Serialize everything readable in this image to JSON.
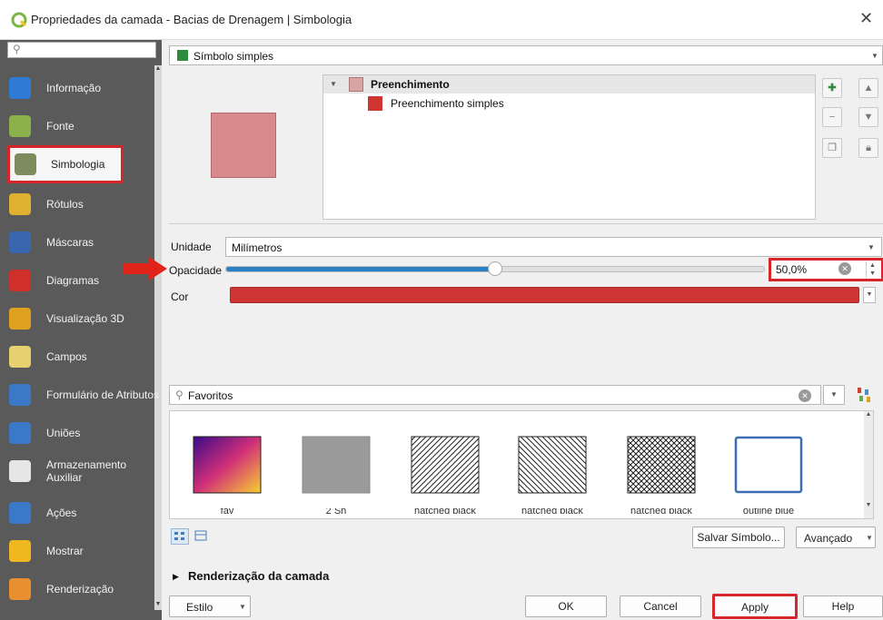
{
  "window": {
    "title": "Propriedades da camada - Bacias de Drenagem | Simbologia"
  },
  "sidebar": {
    "items": [
      {
        "label": "Informação",
        "icon": "info-icon",
        "color": "#2e7bd6"
      },
      {
        "label": "Fonte",
        "icon": "source-icon",
        "color": "#8bb14b"
      },
      {
        "label": "Simbologia",
        "icon": "symbology-brush-icon",
        "color": "#7e8b5f"
      },
      {
        "label": "Rótulos",
        "icon": "labels-abc-icon",
        "color": "#e0b030"
      },
      {
        "label": "Máscaras",
        "icon": "masks-abc-icon",
        "color": "#3a66b0"
      },
      {
        "label": "Diagramas",
        "icon": "diagrams-icon",
        "color": "#d0302b"
      },
      {
        "label": "Visualização 3D",
        "icon": "cube-3d-icon",
        "color": "#e0a020"
      },
      {
        "label": "Campos",
        "icon": "fields-table-icon",
        "color": "#e8d070"
      },
      {
        "label": "Formulário de Atributos",
        "icon": "attribute-form-icon",
        "color": "#3b78c6"
      },
      {
        "label": "Uniões",
        "icon": "joins-icon",
        "color": "#3a79c7"
      },
      {
        "label": "Armazenamento Auxiliar",
        "icon": "auxiliary-storage-icon",
        "color": "#e6e6e6"
      },
      {
        "label": "Ações",
        "icon": "actions-gear-icon",
        "color": "#3a79c7"
      },
      {
        "label": "Mostrar",
        "icon": "display-tooltip-icon",
        "color": "#f0b820"
      },
      {
        "label": "Renderização",
        "icon": "rendering-brush-icon",
        "color": "#e89030"
      }
    ]
  },
  "symbol_type": {
    "value": "Símbolo simples"
  },
  "tree": {
    "parent": "Preenchimento",
    "child": "Preenchimento simples",
    "parent_color": "#d9a3a6",
    "child_color": "#cf3533"
  },
  "props": {
    "unit_label": "Unidade",
    "unit_value": "Milímetros",
    "opacity_label": "Opacidade",
    "opacity_value": "50,0%",
    "opacity_fraction": 0.5,
    "color_label": "Cor",
    "fill_color": "#cf3533"
  },
  "library": {
    "search_placeholder": "Favoritos",
    "tiles": [
      {
        "kind": "gradient",
        "caption": "fav"
      },
      {
        "kind": "gray",
        "caption": "2 Sh"
      },
      {
        "kind": "hatch-right",
        "caption": "hatched black"
      },
      {
        "kind": "hatch-left",
        "caption": "hatched black"
      },
      {
        "kind": "crosshatch",
        "caption": "hatched black"
      },
      {
        "kind": "outline-blue",
        "caption": "outline blue"
      }
    ]
  },
  "buttons": {
    "save_symbol": "Salvar Símbolo...",
    "advanced": "Avançado",
    "style": "Estilo",
    "ok": "OK",
    "cancel": "Cancel",
    "apply": "Apply",
    "help": "Help"
  },
  "section": {
    "rendering": "Renderização da camada"
  },
  "accent": {
    "highlight": "#d6262b",
    "slider": "#2b7fc3"
  }
}
